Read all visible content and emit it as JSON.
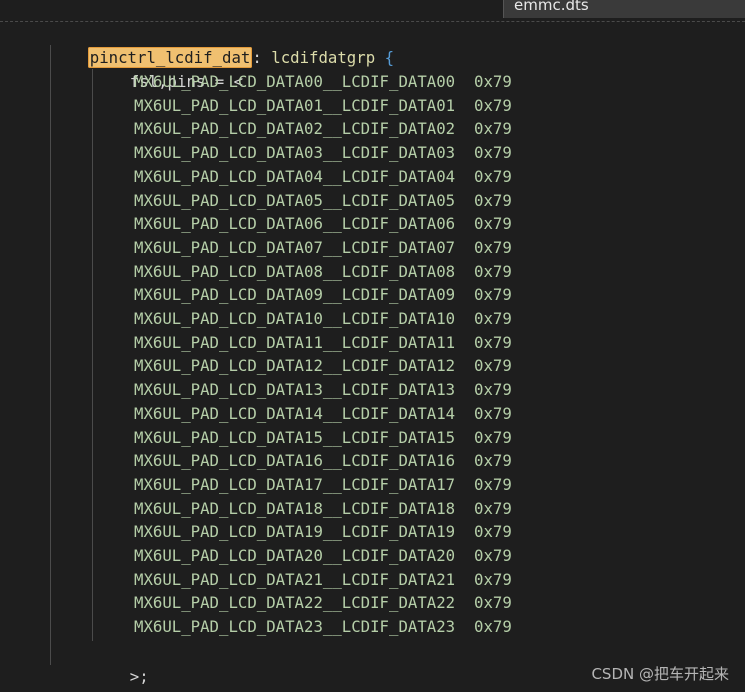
{
  "tab": {
    "filename": "emmc.dts"
  },
  "code": {
    "node_label": "pinctrl_lcdif_dat",
    "node_colon": ":",
    "node_name": "lcdifdatgrp",
    "open_brace": "{",
    "property_line": "fsl,pins = <",
    "pins": [
      {
        "pad": "MX6UL_PAD_LCD_DATA00__LCDIF_DATA00",
        "value": "0x79"
      },
      {
        "pad": "MX6UL_PAD_LCD_DATA01__LCDIF_DATA01",
        "value": "0x79"
      },
      {
        "pad": "MX6UL_PAD_LCD_DATA02__LCDIF_DATA02",
        "value": "0x79"
      },
      {
        "pad": "MX6UL_PAD_LCD_DATA03__LCDIF_DATA03",
        "value": "0x79"
      },
      {
        "pad": "MX6UL_PAD_LCD_DATA04__LCDIF_DATA04",
        "value": "0x79"
      },
      {
        "pad": "MX6UL_PAD_LCD_DATA05__LCDIF_DATA05",
        "value": "0x79"
      },
      {
        "pad": "MX6UL_PAD_LCD_DATA06__LCDIF_DATA06",
        "value": "0x79"
      },
      {
        "pad": "MX6UL_PAD_LCD_DATA07__LCDIF_DATA07",
        "value": "0x79"
      },
      {
        "pad": "MX6UL_PAD_LCD_DATA08__LCDIF_DATA08",
        "value": "0x79"
      },
      {
        "pad": "MX6UL_PAD_LCD_DATA09__LCDIF_DATA09",
        "value": "0x79"
      },
      {
        "pad": "MX6UL_PAD_LCD_DATA10__LCDIF_DATA10",
        "value": "0x79"
      },
      {
        "pad": "MX6UL_PAD_LCD_DATA11__LCDIF_DATA11",
        "value": "0x79"
      },
      {
        "pad": "MX6UL_PAD_LCD_DATA12__LCDIF_DATA12",
        "value": "0x79"
      },
      {
        "pad": "MX6UL_PAD_LCD_DATA13__LCDIF_DATA13",
        "value": "0x79"
      },
      {
        "pad": "MX6UL_PAD_LCD_DATA14__LCDIF_DATA14",
        "value": "0x79"
      },
      {
        "pad": "MX6UL_PAD_LCD_DATA15__LCDIF_DATA15",
        "value": "0x79"
      },
      {
        "pad": "MX6UL_PAD_LCD_DATA16__LCDIF_DATA16",
        "value": "0x79"
      },
      {
        "pad": "MX6UL_PAD_LCD_DATA17__LCDIF_DATA17",
        "value": "0x79"
      },
      {
        "pad": "MX6UL_PAD_LCD_DATA18__LCDIF_DATA18",
        "value": "0x79"
      },
      {
        "pad": "MX6UL_PAD_LCD_DATA19__LCDIF_DATA19",
        "value": "0x79"
      },
      {
        "pad": "MX6UL_PAD_LCD_DATA20__LCDIF_DATA20",
        "value": "0x79"
      },
      {
        "pad": "MX6UL_PAD_LCD_DATA21__LCDIF_DATA21",
        "value": "0x79"
      },
      {
        "pad": "MX6UL_PAD_LCD_DATA22__LCDIF_DATA22",
        "value": "0x79"
      },
      {
        "pad": "MX6UL_PAD_LCD_DATA23__LCDIF_DATA23",
        "value": "0x79"
      }
    ],
    "property_close": ">;",
    "node_close": "};"
  },
  "watermark": "CSDN @把车开起来",
  "colors": {
    "background": "#1e1e1e",
    "selection": "#f0c070",
    "pin_text": "#b5cea8",
    "brace": "#569cd6"
  }
}
